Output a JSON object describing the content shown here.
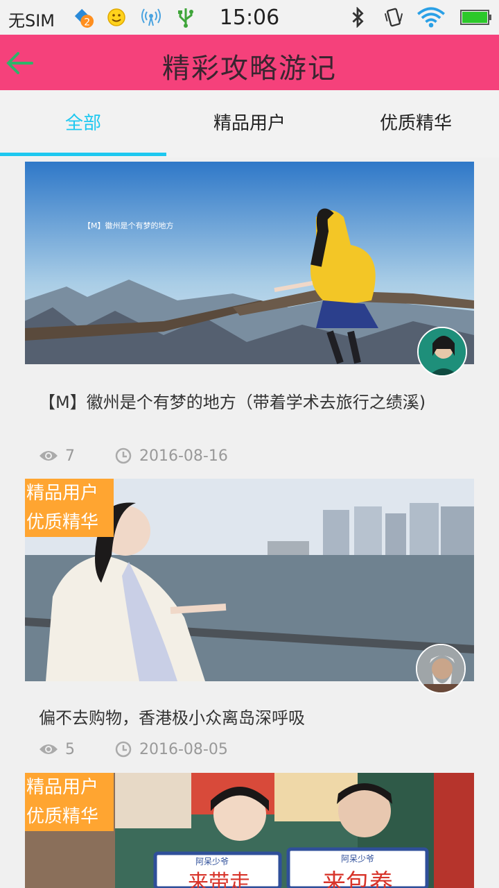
{
  "status_bar": {
    "carrier": "无SIM",
    "time": "15:06",
    "notification_count": "2"
  },
  "header": {
    "title": "精彩攻略游记"
  },
  "tabs": [
    {
      "label": "全部",
      "active": true
    },
    {
      "label": "精品用户",
      "active": false
    },
    {
      "label": "优质精华",
      "active": false
    }
  ],
  "posts": [
    {
      "title": "【M】徽州是个有梦的地方（带着学术去旅行之绩溪)",
      "views": "7",
      "date": "2016-08-16",
      "badges": [],
      "image_overlay_text": "【M】徽州是个有梦的地方"
    },
    {
      "title": "偏不去购物，香港极小众离岛深呼吸",
      "views": "5",
      "date": "2016-08-05",
      "badges": [
        "精品用户",
        "优质精华"
      ]
    },
    {
      "title": "",
      "badges": [
        "精品用户",
        "优质精华"
      ],
      "sign_left": "来带走",
      "sign_right": "来包养",
      "brand": "阿呆少爷"
    }
  ],
  "colors": {
    "header_bg": "#f5417b",
    "tab_active": "#1ec8f0",
    "badge_bg": "#ffa531"
  }
}
